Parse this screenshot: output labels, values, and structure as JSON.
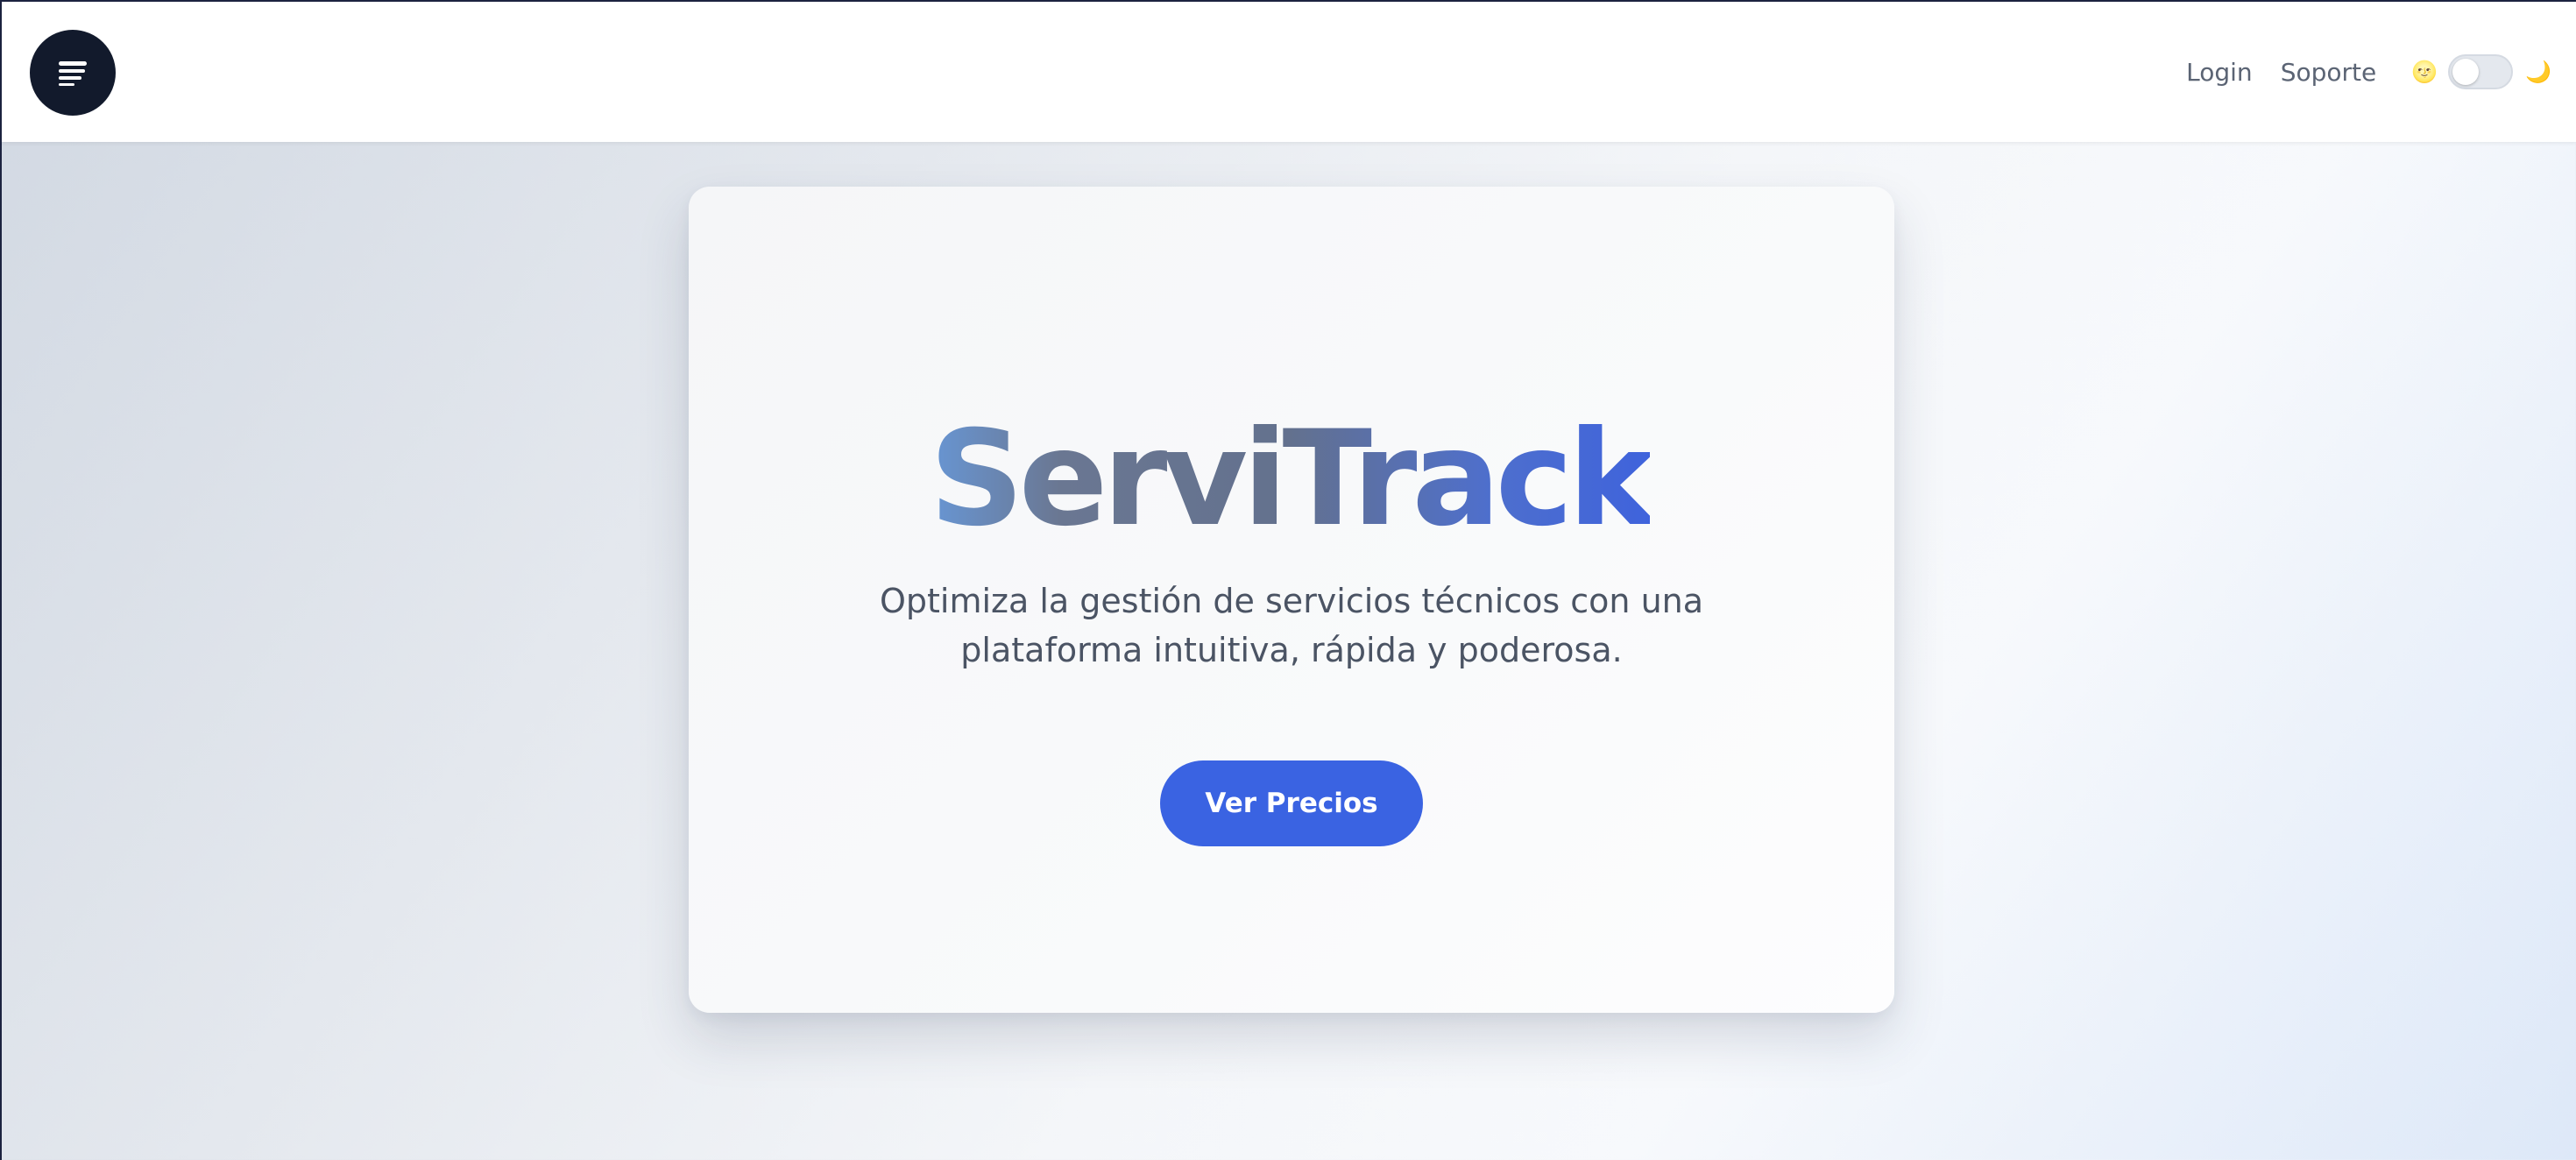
{
  "header": {
    "menu_icon": "menu-lines-icon",
    "nav_links": [
      {
        "label": "Login"
      },
      {
        "label": "Soporte"
      }
    ],
    "theme_toggle": {
      "light_icon": "🌝",
      "dark_icon": "🌙",
      "state": "light"
    }
  },
  "hero": {
    "title": "ServiTrack",
    "subtitle": "Optimiza la gestión de servicios técnicos con una plataforma intuitiva, rápida y poderosa.",
    "cta_label": "Ver Precios"
  },
  "colors": {
    "accent": "#3a63e2",
    "menu_button": "#121a2c",
    "nav_text": "#5b6474",
    "subtitle_text": "#4b5464"
  }
}
